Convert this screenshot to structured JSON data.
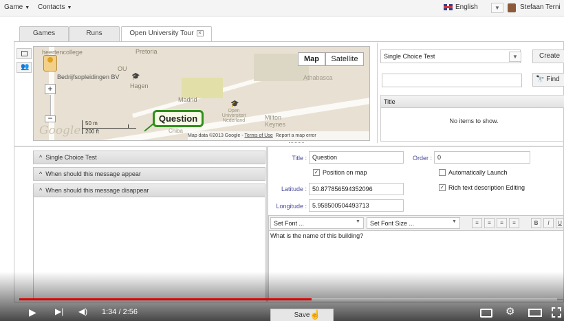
{
  "menu": {
    "game": "Game",
    "contacts": "Contacts"
  },
  "header": {
    "language": "English",
    "user": "Stefaan Terni"
  },
  "tabs": [
    {
      "label": "Games"
    },
    {
      "label": "Runs"
    },
    {
      "label": "Open University Tour"
    }
  ],
  "map": {
    "labels": {
      "college": "heertencollege",
      "bedrijf": "Bedrijfsopleidingen BV",
      "ou": "OU",
      "pretoria": "Pretoria",
      "hagen": "Hagen",
      "madrid": "Madrid",
      "athabasca": "Athabasca",
      "open_univ": "Open Universiteit Nederland",
      "milton": "Milton Keynes",
      "chiba": "Chiba",
      "scale_m": "50 m",
      "scale_ft": "200 ft"
    },
    "type_map": "Map",
    "type_satellite": "Satellite",
    "marker_label": "Question",
    "attribution": "Map data ©2013 Google",
    "terms": "Terms of Use",
    "report": "Report a map error",
    "logo": "Google"
  },
  "panel": {
    "type_select": "Single Choice Test",
    "create_button": "Create",
    "find_button": "Find",
    "table_header": "Title",
    "empty": "No items to show."
  },
  "accordion": [
    {
      "label": "Single Choice Test"
    },
    {
      "label": "When should this message appear"
    },
    {
      "label": "When should this message disappear"
    }
  ],
  "form": {
    "title_label": "Title :",
    "title_value": "Question",
    "order_label": "Order :",
    "order_value": "0",
    "position_on_map": "Position on map",
    "auto_launch": "Automatically Launch",
    "rich_text": "Rich text description Editing",
    "latitude_label": "Latitude :",
    "latitude_value": "50.877856594352096",
    "longitude_label": "Longitude :",
    "longitude_value": "5.958500504493713",
    "font_select": "Set Font ...",
    "font_size_select": "Set Font Size ...",
    "editor_text": "What is the name of this building?",
    "save_button": "Save"
  },
  "video": {
    "time": "1:34 / 2:56",
    "progress": 0.544
  },
  "colors": {
    "progress": "#e00000",
    "marker_border": "#2f8f1a"
  }
}
